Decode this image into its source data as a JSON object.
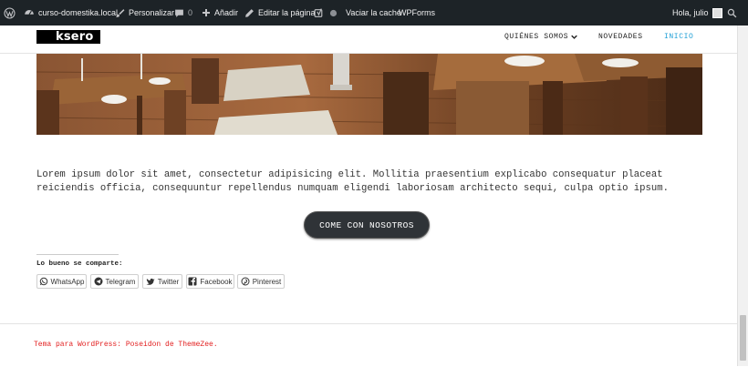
{
  "admin_bar": {
    "site_name": "curso-domestika.local",
    "customize": "Personalizar",
    "comments_count": "0",
    "add_new": "Añadir",
    "edit_page": "Editar la página",
    "clear_cache": "Vaciar la caché",
    "wpforms": "WPForms",
    "greeting": "Hola, julio"
  },
  "header": {
    "logo_text": "ksero",
    "nav": [
      {
        "label": "QUIÉNES SOMOS",
        "has_dropdown": true
      },
      {
        "label": "NOVEDADES"
      },
      {
        "label": "INICIO",
        "active": true
      }
    ]
  },
  "content": {
    "intro": "Lorem ipsum dolor sit amet, consectetur adipisicing elit. Mollitia praesentium explicabo consequatur placeat reiciendis officia, consequuntur repellendus numquam eligendi laboriosam architecto sequi, culpa optio ipsum.",
    "cta_label": "COME CON NOSOTROS"
  },
  "share": {
    "title": "Lo bueno se comparte:",
    "buttons": [
      "WhatsApp",
      "Telegram",
      "Twitter",
      "Facebook",
      "Pinterest"
    ]
  },
  "footer": {
    "credit": "Tema para WordPress: Poseidon de ThemeZee."
  },
  "colors": {
    "admin_bar_bg": "#1d2327",
    "nav_active": "#1e9fd6",
    "cta_bg": "#2f3337",
    "credit_text": "#e21e1e"
  }
}
